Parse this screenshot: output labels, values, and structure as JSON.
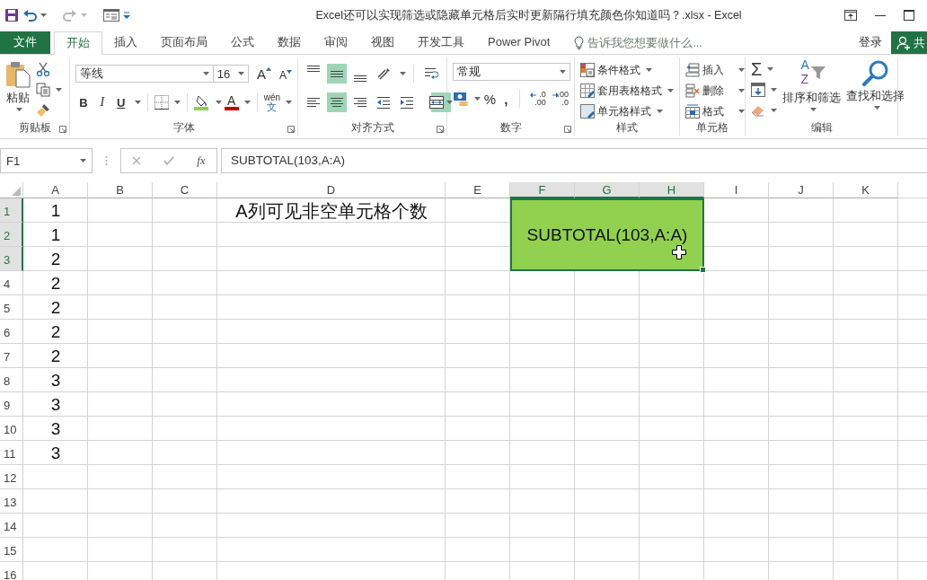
{
  "title_bar": {
    "title": "Excel还可以实现筛选或隐藏单元格后实时更新隔行填充颜色你知道吗？.xlsx - Excel"
  },
  "tabs": [
    {
      "label": "文件",
      "kind": "file",
      "selected": false
    },
    {
      "label": "开始",
      "kind": "tab",
      "selected": true
    },
    {
      "label": "插入",
      "kind": "tab",
      "selected": false
    },
    {
      "label": "页面布局",
      "kind": "tab",
      "selected": false
    },
    {
      "label": "公式",
      "kind": "tab",
      "selected": false
    },
    {
      "label": "数据",
      "kind": "tab",
      "selected": false
    },
    {
      "label": "审阅",
      "kind": "tab",
      "selected": false
    },
    {
      "label": "视图",
      "kind": "tab",
      "selected": false
    },
    {
      "label": "开发工具",
      "kind": "tab",
      "selected": false
    },
    {
      "label": "Power Pivot",
      "kind": "tab",
      "selected": false
    }
  ],
  "tell_me": {
    "placeholder": "告诉我您想要做什么..."
  },
  "sign_in": "登录",
  "share": "共",
  "ribbon": {
    "clipboard": {
      "label": "剪贴板",
      "paste": "粘贴"
    },
    "font": {
      "label": "字体",
      "font_name": "等线",
      "font_size": "16",
      "grow": "A",
      "shrink": "A",
      "bold": "B",
      "italic": "I",
      "underline": "U",
      "font_color": "A",
      "phonetic_top": "wén",
      "phonetic_bottom": "文"
    },
    "alignment": {
      "label": "对齐方式",
      "top_row": [
        {
          "kind": "top",
          "on": false
        },
        {
          "kind": "middle",
          "on": true
        },
        {
          "kind": "bottom",
          "on": false
        },
        {
          "kind": "orientation",
          "on": false
        },
        {
          "kind": "wrap",
          "on": false
        }
      ],
      "bottom_row": [
        {
          "kind": "left",
          "on": false
        },
        {
          "kind": "center",
          "on": true
        },
        {
          "kind": "right",
          "on": false
        },
        {
          "kind": "outdent",
          "on": false
        },
        {
          "kind": "indent",
          "on": false
        },
        {
          "kind": "merge",
          "on": true
        }
      ]
    },
    "number": {
      "label": "数字",
      "format": "常规",
      "percent": "%",
      "comma": ",",
      "increase_decimal": [
        ".0",
        ".00"
      ],
      "decrease_decimal": [
        ".00",
        ".0"
      ]
    },
    "styles": {
      "label": "样式",
      "items": [
        "条件格式",
        "套用表格格式",
        "单元格样式"
      ]
    },
    "cells": {
      "label": "单元格",
      "items": [
        "插入",
        "删除",
        "格式"
      ]
    },
    "editing": {
      "label": "编辑",
      "sum": "Σ",
      "sort_letters": [
        "A",
        "Z"
      ],
      "sort": "排序和筛选",
      "find": "查找和选择"
    }
  },
  "formula_bar": {
    "name_box": "F1",
    "fx": "fx",
    "formula": "SUBTOTAL(103,A:A)"
  },
  "sheet": {
    "columns": [
      {
        "label": "A",
        "selected": false
      },
      {
        "label": "B",
        "selected": false
      },
      {
        "label": "C",
        "selected": false
      },
      {
        "label": "D",
        "selected": false
      },
      {
        "label": "E",
        "selected": false
      },
      {
        "label": "F",
        "selected": true
      },
      {
        "label": "G",
        "selected": true
      },
      {
        "label": "H",
        "selected": true
      },
      {
        "label": "I",
        "selected": false
      },
      {
        "label": "J",
        "selected": false
      },
      {
        "label": "K",
        "selected": false
      }
    ],
    "rows": [
      {
        "label": "1",
        "selected": true,
        "cells": [
          "1",
          "",
          "",
          "A列可见非空单元格个数"
        ]
      },
      {
        "label": "2",
        "selected": true,
        "cells": [
          "1"
        ]
      },
      {
        "label": "3",
        "selected": true,
        "cells": [
          "2"
        ]
      },
      {
        "label": "4",
        "selected": false,
        "cells": [
          "2"
        ]
      },
      {
        "label": "5",
        "selected": false,
        "cells": [
          "2"
        ]
      },
      {
        "label": "6",
        "selected": false,
        "cells": [
          "2"
        ]
      },
      {
        "label": "7",
        "selected": false,
        "cells": [
          "2"
        ]
      },
      {
        "label": "8",
        "selected": false,
        "cells": [
          "3"
        ]
      },
      {
        "label": "9",
        "selected": false,
        "cells": [
          "3"
        ]
      },
      {
        "label": "10",
        "selected": false,
        "cells": [
          "3"
        ]
      },
      {
        "label": "11",
        "selected": false,
        "cells": [
          "3"
        ]
      },
      {
        "label": "12",
        "selected": false,
        "cells": []
      },
      {
        "label": "13",
        "selected": false,
        "cells": []
      },
      {
        "label": "14",
        "selected": false,
        "cells": []
      },
      {
        "label": "15",
        "selected": false,
        "cells": []
      },
      {
        "label": "16",
        "selected": false,
        "cells": []
      }
    ],
    "merged": {
      "text": "SUBTOTAL(103,A:A)",
      "color": "#92d050"
    }
  }
}
